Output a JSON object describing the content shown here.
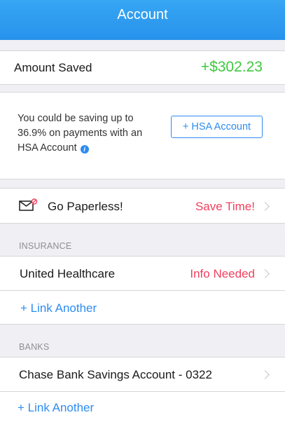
{
  "header": {
    "title": "Account"
  },
  "savings": {
    "label": "Amount Saved",
    "value": "+$302.23"
  },
  "promo": {
    "text": "You could be saving up to 36.9% on payments with an HSA Account",
    "button_label": "+ HSA Account",
    "info_icon": "i"
  },
  "paperless": {
    "label": "Go Paperless!",
    "action": "Save Time!"
  },
  "insurance": {
    "section_title": "INSURANCE",
    "items": [
      {
        "label": "United Healthcare",
        "status": "Info Needed"
      }
    ],
    "link_label": "+ Link Another"
  },
  "banks": {
    "section_title": "BANKS",
    "items": [
      {
        "label": "Chase Bank Savings Account - 0322"
      }
    ],
    "link_label": "+ Link Another"
  },
  "colors": {
    "header": "#2792ec",
    "accent_blue": "#2e8cf0",
    "positive_green": "#3ec93e",
    "alert_red": "#f0405e"
  },
  "icons": {
    "paperless": "mail-notification-icon",
    "row_disclosure": "chevron-right-icon"
  }
}
